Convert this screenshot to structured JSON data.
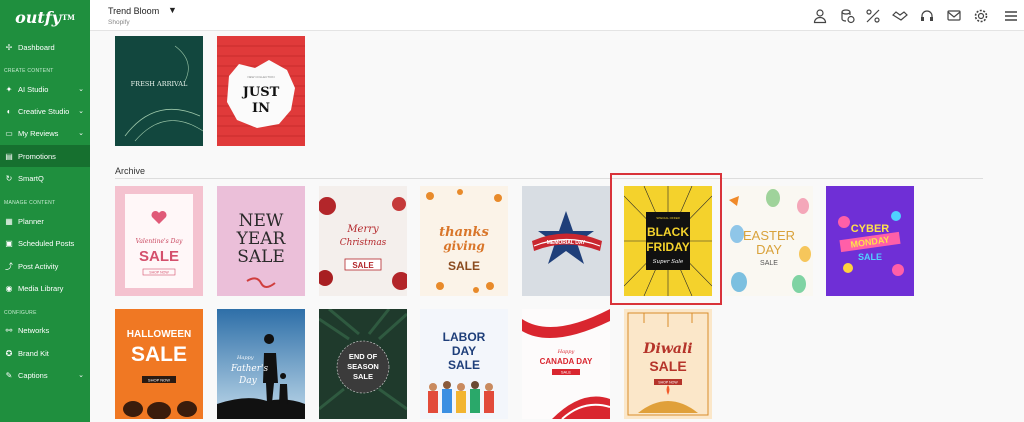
{
  "app": {
    "logo": "outfy",
    "logo_mark": "TM"
  },
  "header": {
    "store_name": "Trend Bloom",
    "store_platform": "Shopify"
  },
  "sidebar": {
    "dashboard": "Dashboard",
    "create_section": "CREATE CONTENT",
    "ai_studio": "AI Studio",
    "creative_studio": "Creative Studio",
    "my_reviews": "My Reviews",
    "promotions": "Promotions",
    "smartq": "SmartQ",
    "manage_section": "MANAGE CONTENT",
    "planner": "Planner",
    "scheduled_posts": "Scheduled Posts",
    "post_activity": "Post Activity",
    "media_library": "Media Library",
    "configure_section": "CONFIGURE",
    "networks": "Networks",
    "brand_kit": "Brand Kit",
    "captions": "Captions"
  },
  "main": {
    "archive_title": "Archive",
    "top_cards": [
      {
        "line1": "FRESH ARRIVAL"
      },
      {
        "small": "NEW COLLECTION",
        "line1": "JUST",
        "line2": "IN"
      }
    ],
    "archive_cards": [
      {
        "line1": "Valentine's Day",
        "line2": "SALE",
        "btn": "SHOP NOW"
      },
      {
        "line1": "NEW",
        "line2": "YEAR",
        "line3": "SALE"
      },
      {
        "line1": "Merry",
        "line2": "Christmas",
        "line3": "SALE"
      },
      {
        "line1": "thanks",
        "line2": "giving",
        "line3": "SALE"
      },
      {
        "line1": "MEMORIAL DAY"
      },
      {
        "small": "SPECIAL OFFER",
        "line1": "BLACK",
        "line2": "FRIDAY",
        "line3": "Super Sale"
      },
      {
        "line1": "EASTER",
        "line2": "DAY",
        "line3": "SALE"
      },
      {
        "line1": "CYBER",
        "line2": "MONDAY",
        "line3": "SALE"
      },
      {
        "line1": "HALLOWEEN",
        "line2": "SALE",
        "btn": "SHOP NOW"
      },
      {
        "line1": "Happy",
        "line2": "Father's",
        "line3": "Day"
      },
      {
        "line1": "END OF",
        "line2": "SEASON",
        "line3": "SALE"
      },
      {
        "line1": "LABOR",
        "line2": "DAY",
        "line3": "SALE"
      },
      {
        "line1": "Happy",
        "line2": "CANADA DAY",
        "line3": "SALE"
      },
      {
        "line1": "Diwali",
        "line2": "SALE",
        "btn": "SHOP NOW"
      }
    ]
  }
}
